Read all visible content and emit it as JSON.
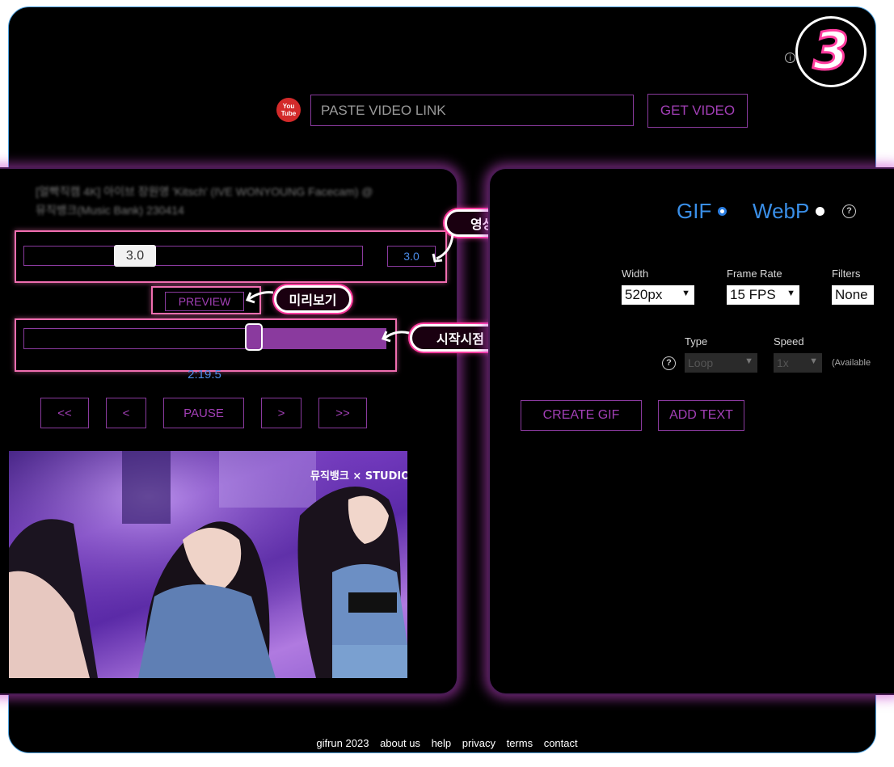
{
  "badge": {
    "number": "3"
  },
  "header": {
    "info_icon": "i",
    "youtube_icon_top": "You",
    "youtube_icon_bottom": "Tube",
    "url_placeholder": "PASTE VIDEO LINK",
    "get_video_label": "GET VIDEO"
  },
  "video": {
    "title": "[얼빡직캠 4K] 아이브 장원영 'Kitsch' (IVE WONYOUNG Facecam) @뮤직뱅크(Music Bank) 230414",
    "duration_slider_value": "3.0",
    "duration_box_value": "3.0",
    "preview_label": "PREVIEW",
    "start_time": "2:19.5",
    "start_fraction": 0.47,
    "controls": [
      "<<",
      "<",
      "PAUSE",
      ">",
      ">>"
    ],
    "watermark": "뮤직뱅크 × STUDIO"
  },
  "callouts": {
    "duration": "영상길이 설정",
    "preview": "미리보기",
    "start": "시작시점 설정"
  },
  "format": {
    "options": [
      "GIF",
      "WebP"
    ],
    "selected": "GIF",
    "help_icon": "?"
  },
  "settings": {
    "width_label": "Width",
    "width_value": "520px",
    "frame_rate_label": "Frame Rate",
    "frame_rate_value": "15 FPS",
    "filters_label": "Filters",
    "filters_value": "None",
    "type_label": "Type",
    "type_value": "Loop",
    "speed_label": "Speed",
    "speed_value": "1x",
    "available_note": "(Available",
    "help_icon": "?"
  },
  "actions": {
    "create_gif": "CREATE GIF",
    "add_text": "ADD TEXT"
  },
  "footer": {
    "brand": "gifrun 2023",
    "links": [
      "about us",
      "help",
      "privacy",
      "terms",
      "contact"
    ]
  },
  "colors": {
    "accent": "#8a3a9e",
    "link_blue": "#3a8fe8",
    "callout_pink": "#ff3c9e",
    "glow": "#c846d2"
  }
}
